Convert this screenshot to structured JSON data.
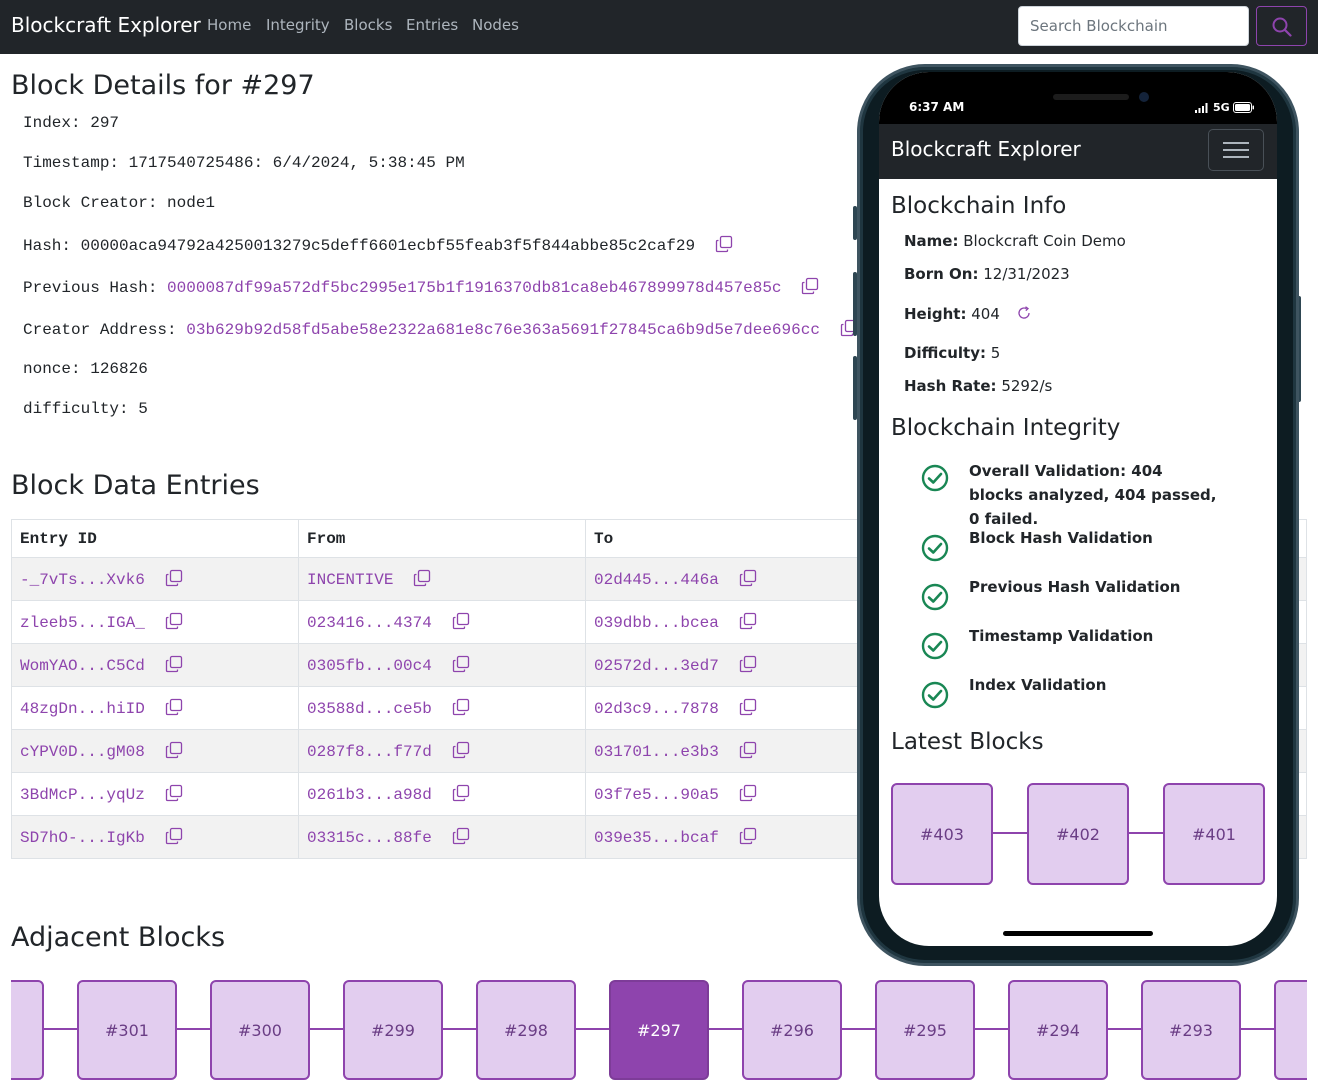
{
  "navbar": {
    "brand": "Blockcraft Explorer",
    "links": [
      "Home",
      "Integrity",
      "Blocks",
      "Entries",
      "Nodes"
    ],
    "search_placeholder": "Search Blockchain",
    "search_icon": "search-icon"
  },
  "block_details": {
    "heading": "Block Details for #297",
    "index": "Index: 297",
    "timestamp": "Timestamp: 1717540725486: 6/4/2024, 5:38:45 PM",
    "creator": "Block Creator: node1",
    "hash_label": "Hash: ",
    "hash": "00000aca94792a4250013279c5deff6601ecbf55feab3f5f844abbe85c2caf29",
    "prev_hash_label": "Previous Hash: ",
    "prev_hash": "0000087df99a572df5bc2995e175b1f1916370db81ca8eb467899978d457e85c",
    "creator_address_label": "Creator Address: ",
    "creator_address": "03b629b92d58fd5abe58e2322a681e8c76e363a5691f27845ca6b9d5e7dee696cc",
    "nonce": "nonce: 126826",
    "difficulty": "difficulty: 5"
  },
  "entries": {
    "heading": "Block Data Entries",
    "columns": [
      "Entry ID",
      "From",
      "To"
    ],
    "rows": [
      [
        "-_7vTs...Xvk6",
        "INCENTIVE",
        "02d445...446a"
      ],
      [
        "zleeb5...IGA_",
        "023416...4374",
        "039dbb...bcea"
      ],
      [
        "WomYAO...C5Cd",
        "0305fb...00c4",
        "02572d...3ed7"
      ],
      [
        "48zgDn...hiID",
        "03588d...ce5b",
        "02d3c9...7878"
      ],
      [
        "cYPV0D...gM08",
        "0287f8...f77d",
        "031701...e3b3"
      ],
      [
        "3BdMcP...yqUz",
        "0261b3...a98d",
        "03f7e5...90a5"
      ],
      [
        "SD7hO-...IgKb",
        "03315c...88fe",
        "039e35...bcaf"
      ]
    ]
  },
  "adjacent": {
    "heading": "Adjacent Blocks",
    "blocks": [
      "#301",
      "#300",
      "#299",
      "#298",
      "#297",
      "#296",
      "#295",
      "#294",
      "#293"
    ],
    "active": "#297"
  },
  "phone": {
    "status_time": "6:37 AM",
    "status_network": "5G",
    "brand": "Blockcraft Explorer",
    "info_heading": "Blockchain Info",
    "info": {
      "name_label": "Name:",
      "name": "Blockcraft Coin Demo",
      "born_label": "Born On:",
      "born": "12/31/2023",
      "height_label": "Height:",
      "height": "404",
      "difficulty_label": "Difficulty:",
      "difficulty": "5",
      "hashrate_label": "Hash Rate:",
      "hashrate": "5292/s"
    },
    "integrity_heading": "Blockchain Integrity",
    "validations": [
      "Overall Validation: 404 blocks analyzed, 404 passed, 0 failed.",
      "Block Hash Validation",
      "Previous Hash Validation",
      "Timestamp Validation",
      "Index Validation"
    ],
    "latest_heading": "Latest Blocks",
    "latest_blocks": [
      "#403",
      "#402",
      "#401"
    ]
  },
  "colors": {
    "accent": "#8e44ad",
    "block_fill": "#e2cdef",
    "navbar": "#212529",
    "success": "#198754"
  }
}
